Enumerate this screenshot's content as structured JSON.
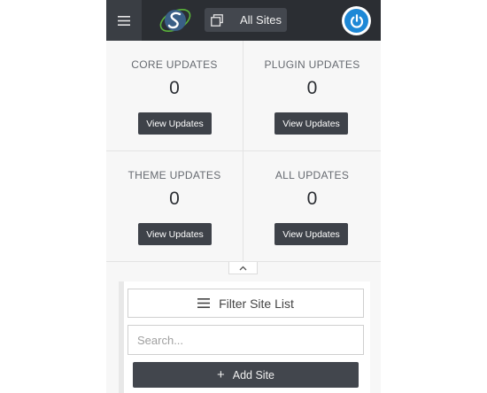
{
  "header": {
    "sites_button_label": "All Sites"
  },
  "updates": [
    {
      "title": "CORE UPDATES",
      "count": "0",
      "button": "View Updates"
    },
    {
      "title": "PLUGIN UPDATES",
      "count": "0",
      "button": "View Updates"
    },
    {
      "title": "THEME UPDATES",
      "count": "0",
      "button": "View Updates"
    },
    {
      "title": "ALL UPDATES",
      "count": "0",
      "button": "View Updates"
    }
  ],
  "sites": {
    "filter_label": "Filter Site List",
    "search_placeholder": "Search...",
    "search_value": "",
    "add_site_label": "Add Site"
  },
  "icons": {
    "menu": "hamburger-icon",
    "logo": "logo-icon",
    "sites": "window-icon",
    "power": "power-icon",
    "collapse": "chevron-up-icon",
    "filter": "hamburger-icon",
    "add": "plus-icon"
  },
  "colors": {
    "header_bg": "#2b2e33",
    "button_bg": "#3e4249",
    "power_accent": "#1e88d6",
    "logo_accent": "#5bb53a",
    "panel_bg": "#f7f7f7"
  }
}
